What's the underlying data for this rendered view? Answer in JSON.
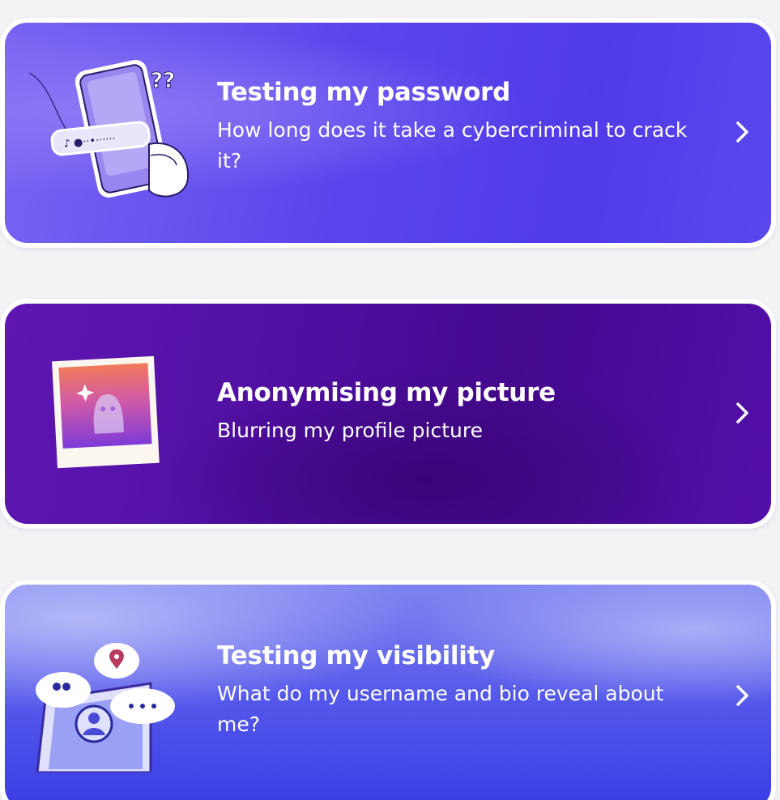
{
  "cards": [
    {
      "title": "Testing my password",
      "subtitle": "How long does it take a cybercriminal to crack it?",
      "illustration": "phone-password-icon",
      "chevron": "chevron-right-icon"
    },
    {
      "title": "Anonymising my picture",
      "subtitle": "Blurring my profile picture",
      "illustration": "blurred-photo-icon",
      "chevron": "chevron-right-icon"
    },
    {
      "title": "Testing my visibility",
      "subtitle": "What do my username and bio reveal about me?",
      "illustration": "profile-visibility-icon",
      "chevron": "chevron-right-icon"
    }
  ],
  "colors": {
    "card1": "#5a45ec",
    "card2": "#4f0ea0",
    "card3": "#5458ea",
    "text": "#ffffff",
    "background": "#f3f3f6"
  }
}
